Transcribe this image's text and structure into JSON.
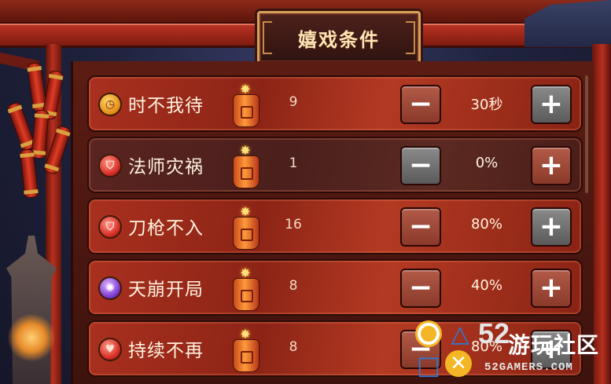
{
  "title": "嬉戏条件",
  "rows": [
    {
      "name": "时不我待",
      "count": "9",
      "value": "30秒",
      "icon": "clock-icon",
      "icon_color": "gold",
      "minus_enabled": true,
      "plus_enabled": true
    },
    {
      "name": "法师灾祸",
      "count": "1",
      "value": "0%",
      "icon": "shield-icon",
      "icon_color": "red",
      "minus_enabled": false,
      "plus_enabled": true
    },
    {
      "name": "刀枪不入",
      "count": "16",
      "value": "80%",
      "icon": "shield-icon",
      "icon_color": "red",
      "minus_enabled": true,
      "plus_enabled": true
    },
    {
      "name": "天崩开局",
      "count": "8",
      "value": "40%",
      "icon": "vortex-icon",
      "icon_color": "purple",
      "minus_enabled": true,
      "plus_enabled": true
    },
    {
      "name": "持续不再",
      "count": "8",
      "value": "80%",
      "icon": "heart-shield-icon",
      "icon_color": "red",
      "minus_enabled": true,
      "plus_enabled": true
    }
  ],
  "buttons": {
    "minus": "−",
    "plus": "+"
  },
  "watermark": {
    "number": "52",
    "text": "游玩社区",
    "domain": "52GAMERS.COM"
  }
}
